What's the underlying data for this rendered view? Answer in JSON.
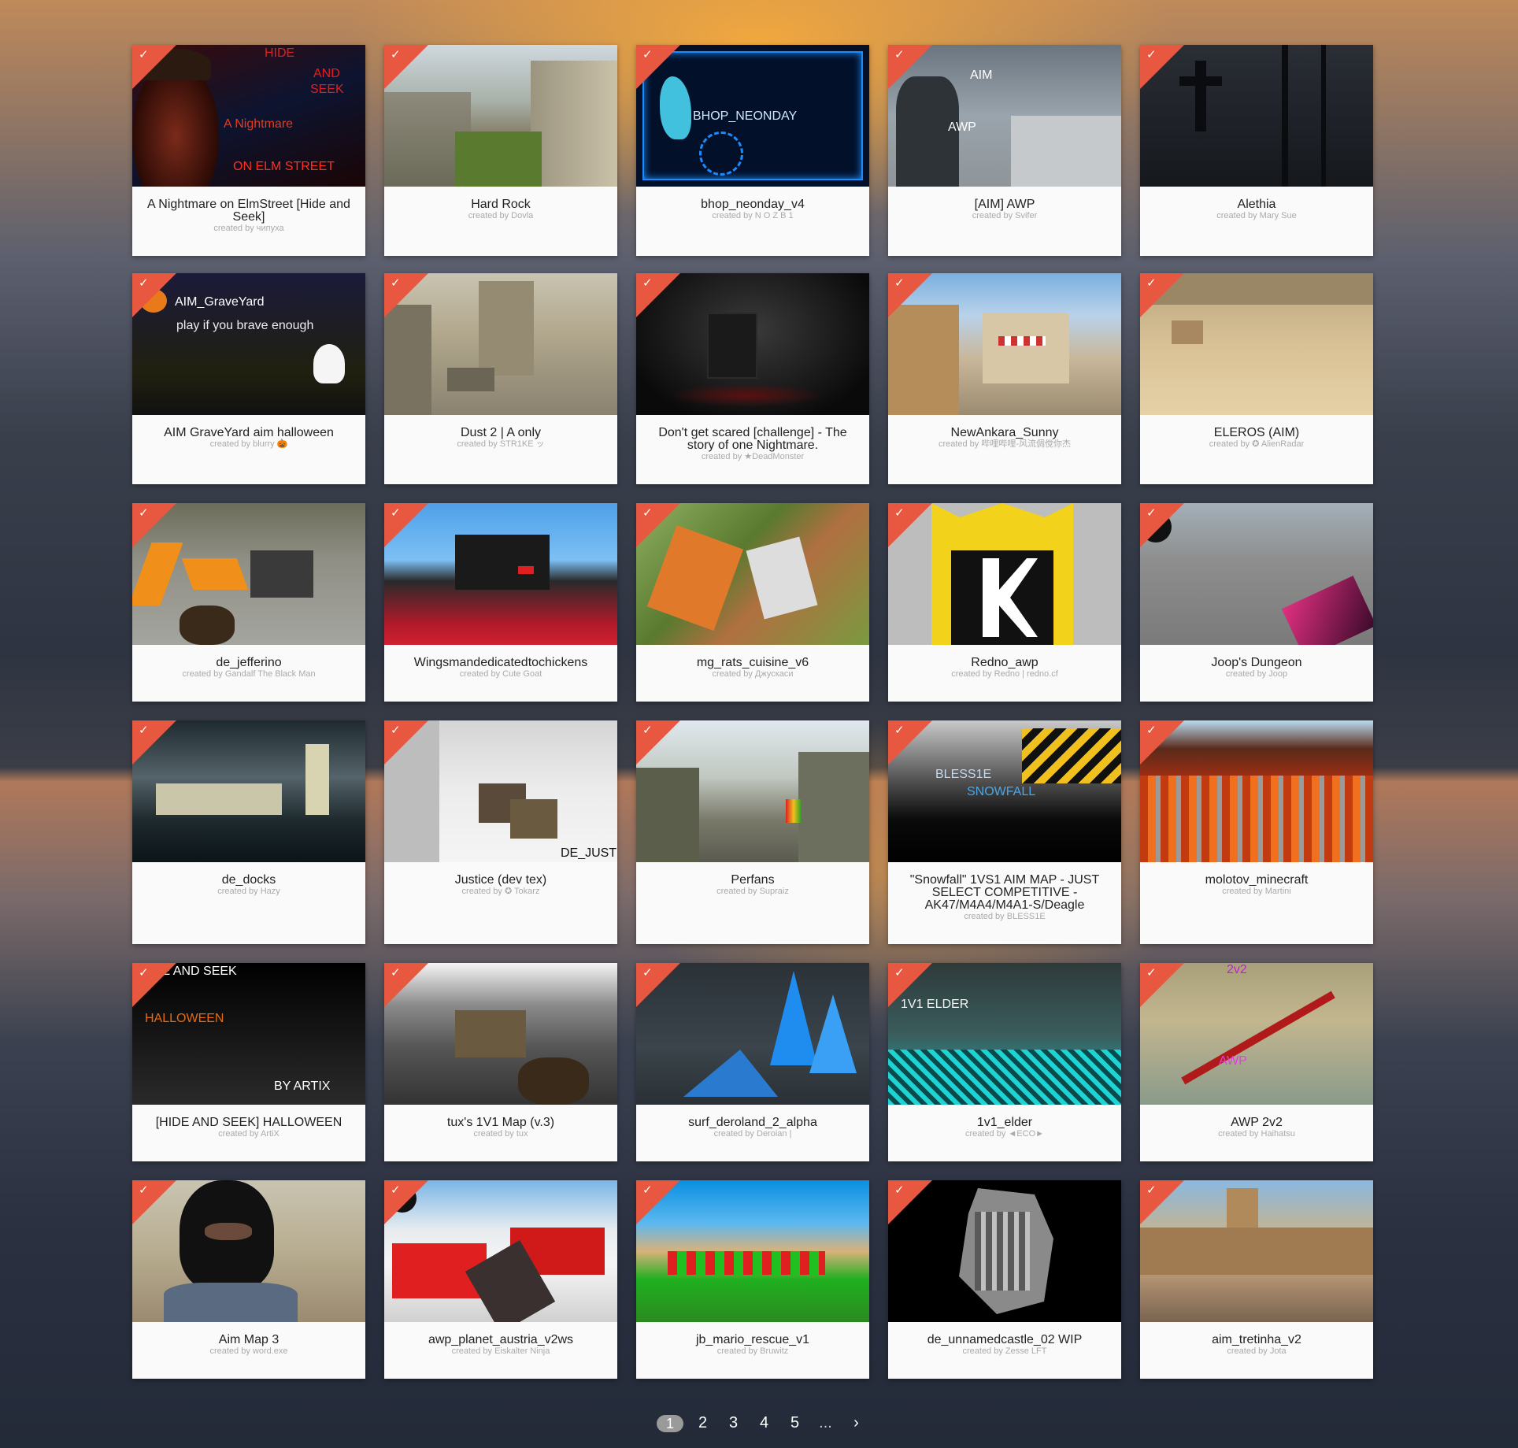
{
  "created_by_prefix": "created by",
  "maps": [
    {
      "title": "A Nightmare on ElmStreet [Hide and Seek]",
      "creator": "чипуха"
    },
    {
      "title": "Hard Rock",
      "creator": "Dovla"
    },
    {
      "title": "bhop_neonday_v4",
      "creator": "N O Z B 1"
    },
    {
      "title": "[AIM] AWP",
      "creator": "Svifer"
    },
    {
      "title": "Alethia",
      "creator": "Mary Sue"
    },
    {
      "title": "AIM GraveYard aim halloween",
      "creator": "blurry 🎃"
    },
    {
      "title": "Dust 2 | A only",
      "creator": "STR1KE ッ"
    },
    {
      "title": "Don't get scared [challenge] - The story of one Nightmare.",
      "creator": "★DeadMonster"
    },
    {
      "title": "NewAnkara_Sunny",
      "creator": "哔哩哔哩-风流倜傥你杰"
    },
    {
      "title": "ELEROS (AIM)",
      "creator": "✪ AlienRadar"
    },
    {
      "title": "de_jefferino",
      "creator": "Gandalf The Black Man"
    },
    {
      "title": "Wingsmandedicatedtochickens",
      "creator": "Cute Goat"
    },
    {
      "title": "mg_rats_cuisine_v6",
      "creator": "Джускаси"
    },
    {
      "title": "Redno_awp",
      "creator": "Redno | redno.cf"
    },
    {
      "title": "Joop's Dungeon",
      "creator": "Joop"
    },
    {
      "title": "de_docks",
      "creator": "Hazy"
    },
    {
      "title": "Justice (dev tex)",
      "creator": "✪ Tokarz"
    },
    {
      "title": "Perfans",
      "creator": "Supraiz"
    },
    {
      "title": "\"Snowfall\" 1VS1 AIM MAP - JUST SELECT COMPETITIVE - AK47/M4A4/M4A1-S/Deagle",
      "creator": "BLESS1E"
    },
    {
      "title": "molotov_minecraft",
      "creator": "Martini"
    },
    {
      "title": "[HIDE AND SEEK] HALLOWEEN",
      "creator": "ArtiX"
    },
    {
      "title": "tux's 1V1 Map (v.3)",
      "creator": "tux"
    },
    {
      "title": "surf_deroland_2_alpha",
      "creator": "Deroian |"
    },
    {
      "title": "1v1_elder",
      "creator": "◄ECO►"
    },
    {
      "title": "AWP 2v2",
      "creator": "Haihatsu"
    },
    {
      "title": "Aim Map 3",
      "creator": "word.exe"
    },
    {
      "title": "awp_planet_austria_v2ws",
      "creator": "Eiskalter Ninja"
    },
    {
      "title": "jb_mario_rescue_v1",
      "creator": "Bruwitz"
    },
    {
      "title": "de_unnamedcastle_02 WIP",
      "creator": "Zesse LFT"
    },
    {
      "title": "aim_tretinha_v2",
      "creator": "Jota"
    }
  ],
  "thumb_texts": {
    "nightmare_1": "HIDE",
    "nightmare_2": "AND",
    "nightmare_3": "SEEK",
    "nightmare_4": "A Nightmare",
    "nightmare_5": "ON ELM STREET",
    "neonday": "BHOP_NEONDAY",
    "aimawp_1": "AIM",
    "aimawp_2": "AWP",
    "graveyard_1": "AIM_GraveYard",
    "graveyard_2": "play if you brave enough",
    "justice": "DE_JUSTICE",
    "snowfall_1": "BLESS1E",
    "snowfall_2": "SNOWFALL",
    "halloween_1": "DE AND SEEK",
    "halloween_2": "HALLOWEEN",
    "halloween_3": "BY ARTIX",
    "elder": "1V1 ELDER",
    "awp2v2_1": "2v2",
    "awp2v2_2": "AWP"
  },
  "pagination": {
    "pages": [
      "1",
      "2",
      "3",
      "4",
      "5"
    ],
    "ellipsis": "...",
    "next": "›",
    "current": "1"
  },
  "colors": {
    "accent": "#e8573f",
    "card_bg": "#fafafa",
    "active_page": "#9a9a9a"
  }
}
